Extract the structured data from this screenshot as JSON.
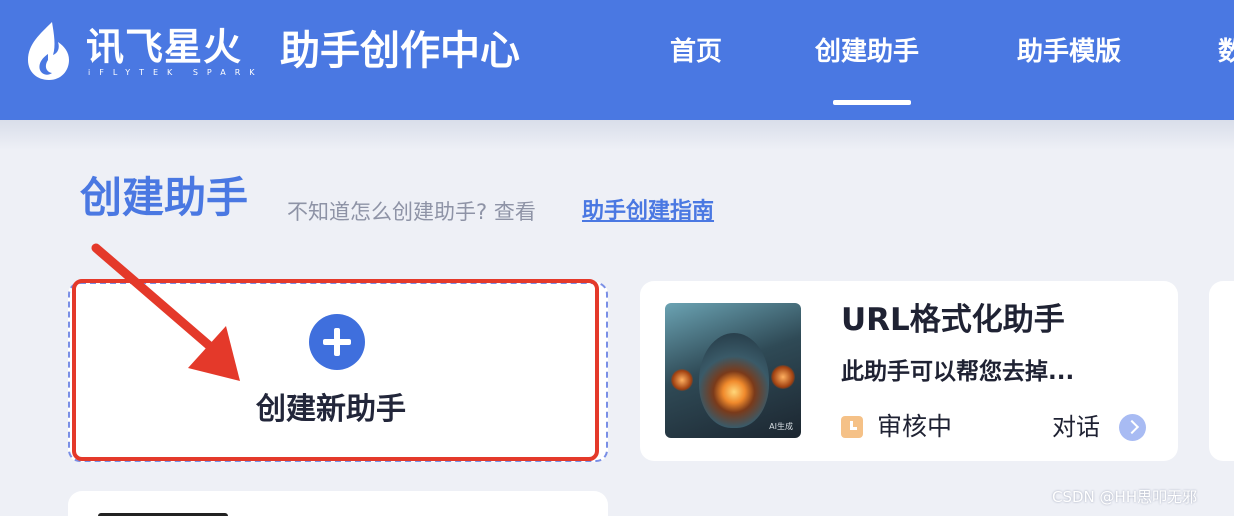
{
  "header": {
    "logo_cn": "讯飞星火",
    "logo_en": "iFLYTEK SPARK",
    "site_title": "助手创作中心",
    "nav": [
      {
        "label": "首页",
        "active": false
      },
      {
        "label": "创建助手",
        "active": true
      },
      {
        "label": "助手模版",
        "active": false
      },
      {
        "label": "数",
        "active": false
      }
    ]
  },
  "main": {
    "section_title": "创建助手",
    "hint_text": "不知道怎么创建助手? 查看",
    "guide_link": "助手创建指南",
    "create_card": {
      "label": "创建新助手",
      "icon": "plus-icon"
    },
    "assistant_card": {
      "title": "URL格式化助手",
      "description": "此助手可以帮您去掉...",
      "thumb_badge": "AI生成",
      "status": "审核中",
      "status_icon": "clock-icon",
      "chat_label": "对话",
      "chat_icon": "chevron-right-icon"
    }
  },
  "watermark": "CSDN @HH思叩无邪",
  "colors": {
    "brand_blue": "#4a78e2",
    "highlight_red": "#e4392a",
    "status_orange": "#f5c187"
  }
}
